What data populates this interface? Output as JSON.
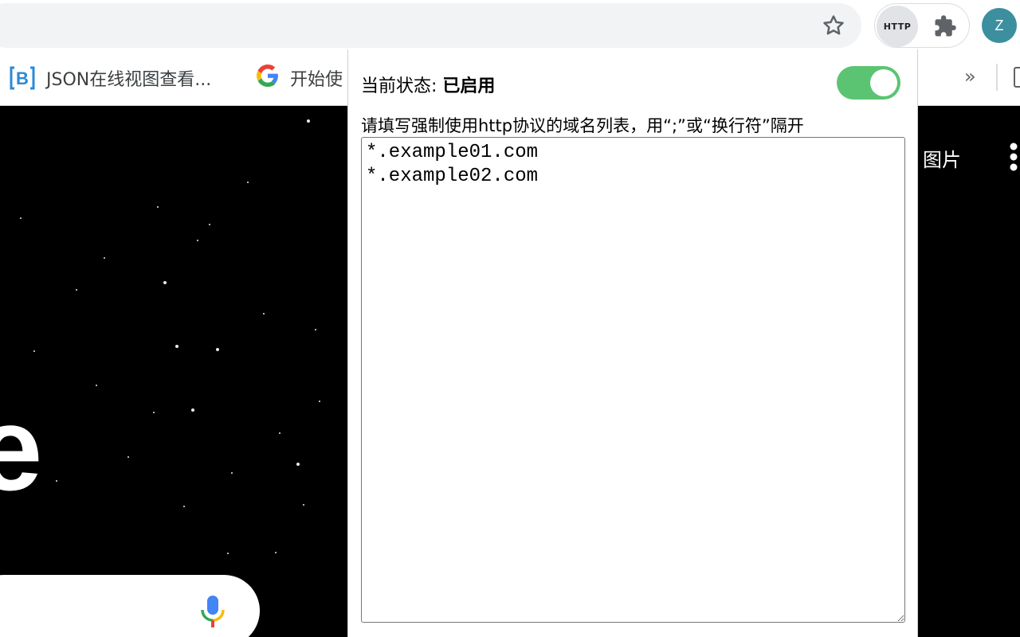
{
  "browser": {
    "http_extension_label": "HTTP",
    "avatar_initial": "Z",
    "icons": {
      "bookmark_star": "star-outline-icon",
      "extensions": "puzzle-icon",
      "bookmarks_overflow": "chevron-double-right-icon"
    }
  },
  "bookmarks": {
    "items": [
      {
        "label": "JSON在线视图查看...",
        "icon": "bejson-logo-icon"
      },
      {
        "label": "开始使",
        "icon": "google-g-icon"
      }
    ],
    "overflow_label": "»"
  },
  "page": {
    "images_link": "图片",
    "logo_fragment": "e",
    "icons": {
      "voice_search": "mic-icon",
      "apps": "apps-grid-icon"
    },
    "background_color": "#000000"
  },
  "popup": {
    "status_label": "当前状态: ",
    "status_value": "已启用",
    "toggle_on": true,
    "toggle_color": "#5bc472",
    "hint": "请填写强制使用http协议的域名列表，用“;”或“换行符”隔开",
    "domains": "*.example01.com\n*.example02.com"
  }
}
